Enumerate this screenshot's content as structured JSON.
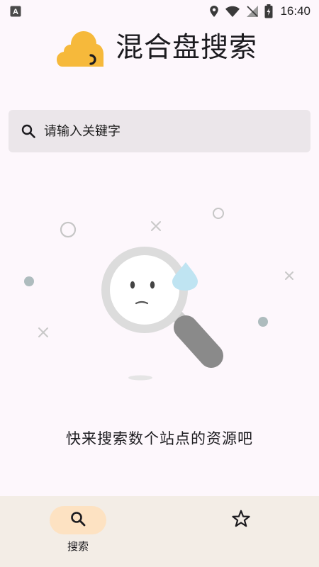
{
  "status_bar": {
    "app_badge": "A",
    "time": "16:40"
  },
  "header": {
    "title": "混合盘搜索"
  },
  "search": {
    "placeholder": "请输入关键字"
  },
  "empty_state": {
    "message": "快来搜索数个站点的资源吧"
  },
  "bottom_nav": {
    "items": [
      {
        "label": "搜索",
        "icon": "search-icon",
        "selected": true
      },
      {
        "label": "",
        "icon": "star-icon",
        "selected": false
      }
    ]
  },
  "colors": {
    "background": "#fdf7fc",
    "search_box": "#ebe6ea",
    "bottom_nav": "#f3ede6",
    "selected_pill": "#fde2c2",
    "logo": "#f6b93b",
    "water_drop": "#bfe4f2"
  }
}
